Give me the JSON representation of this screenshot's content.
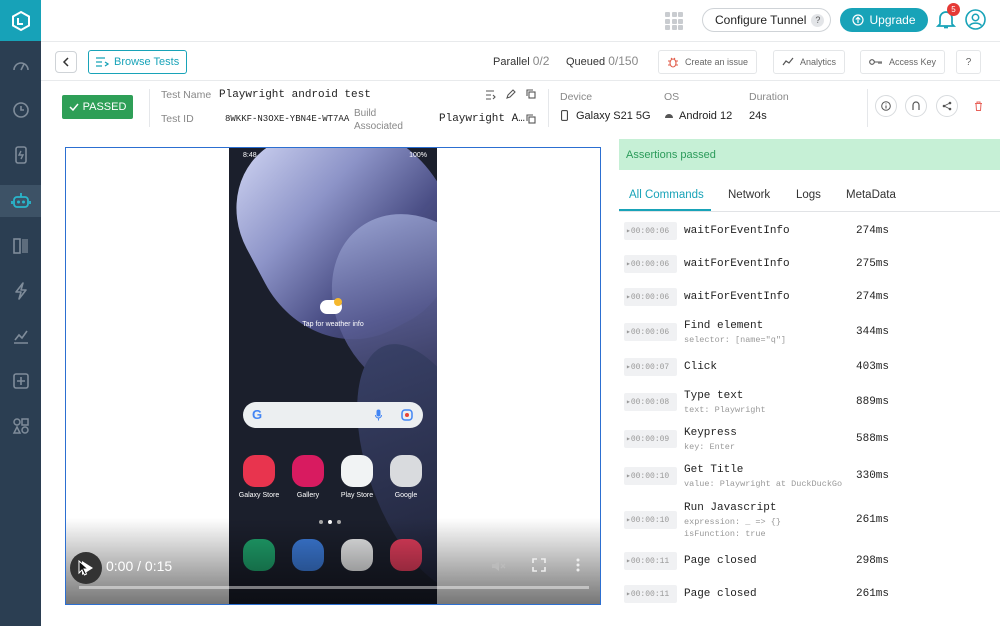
{
  "topbar": {
    "configure_tunnel": "Configure Tunnel",
    "help": "?",
    "upgrade": "Upgrade",
    "notification_count": "5"
  },
  "toolbar": {
    "browse_tests": "Browse Tests",
    "parallel_label": "Parallel",
    "parallel_value": "0/2",
    "queued_label": "Queued",
    "queued_value": "0/150",
    "create_issue": "Create an issue",
    "analytics": "Analytics",
    "access_key": "Access Key",
    "help": "?"
  },
  "test": {
    "status": "PASSED",
    "name_label": "Test Name",
    "name": "Playwright android test",
    "id_label": "Test ID",
    "id": "8WKKF-N3OXE-YBN4E-WT7AA",
    "build_label": "Build Associated",
    "build": "Playwright A…",
    "device_label": "Device",
    "device": "Galaxy S21 5G",
    "os_label": "OS",
    "os": "Android 12",
    "duration_label": "Duration",
    "duration": "24s"
  },
  "phone": {
    "time": "8:48",
    "battery": "100%",
    "weather": "Tap for weather info",
    "apps": [
      "Galaxy Store",
      "Gallery",
      "Play Store",
      "Google"
    ]
  },
  "video": {
    "time": "0:00 / 0:15"
  },
  "panel": {
    "assertions": "Assertions passed",
    "tabs": [
      "All Commands",
      "Network",
      "Logs",
      "MetaData"
    ]
  },
  "commands": [
    {
      "ts": "00:00:06",
      "name": "waitForEventInfo",
      "sub": "",
      "dur": "274ms"
    },
    {
      "ts": "00:00:06",
      "name": "waitForEventInfo",
      "sub": "",
      "dur": "275ms"
    },
    {
      "ts": "00:00:06",
      "name": "waitForEventInfo",
      "sub": "",
      "dur": "274ms"
    },
    {
      "ts": "00:00:06",
      "name": "Find element",
      "sub": "selector: [name=\"q\"]",
      "dur": "344ms"
    },
    {
      "ts": "00:00:07",
      "name": "Click",
      "sub": "",
      "dur": "403ms"
    },
    {
      "ts": "00:00:08",
      "name": "Type text",
      "sub": "text: Playwright",
      "dur": "889ms"
    },
    {
      "ts": "00:00:09",
      "name": "Keypress",
      "sub": "key: Enter",
      "dur": "588ms"
    },
    {
      "ts": "00:00:10",
      "name": "Get Title",
      "sub": "value: Playwright at DuckDuckGo",
      "dur": "330ms"
    },
    {
      "ts": "00:00:10",
      "name": "Run Javascript",
      "sub": "expression: _ => {}",
      "sub2": "isFunction: true",
      "dur": "261ms"
    },
    {
      "ts": "00:00:11",
      "name": "Page closed",
      "sub": "",
      "dur": "298ms"
    },
    {
      "ts": "00:00:11",
      "name": "Page closed",
      "sub": "",
      "dur": "261ms"
    }
  ],
  "colors": {
    "accent": "#18a3b8",
    "sidebar": "#2b3e52",
    "passed": "#2e9f57"
  }
}
